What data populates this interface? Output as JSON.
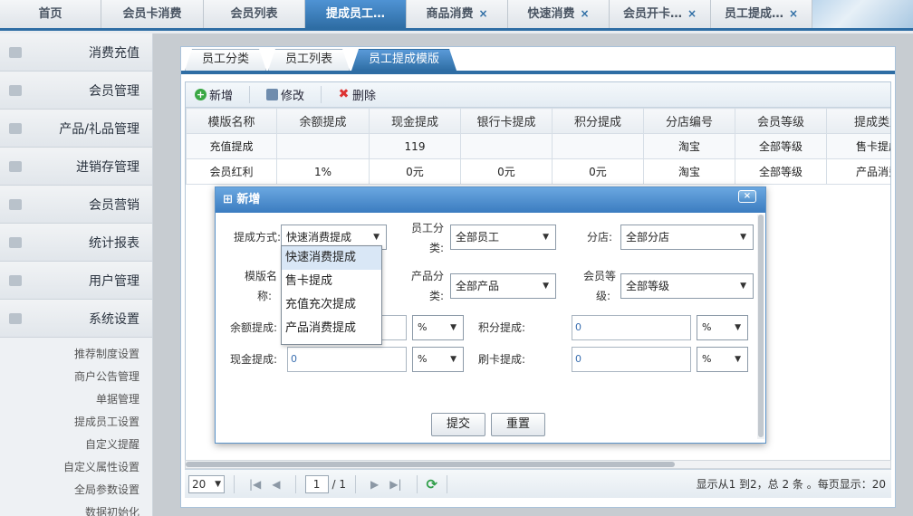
{
  "top_tabs": [
    {
      "label": "首页",
      "closable": false,
      "active": false
    },
    {
      "label": "会员卡消费",
      "closable": false,
      "active": false
    },
    {
      "label": "会员列表",
      "closable": false,
      "active": false
    },
    {
      "label": "提成员工…",
      "closable": false,
      "active": true
    },
    {
      "label": "商品消费",
      "closable": true,
      "active": false
    },
    {
      "label": "快速消费",
      "closable": true,
      "active": false
    },
    {
      "label": "会员开卡…",
      "closable": true,
      "active": false
    },
    {
      "label": "员工提成…",
      "closable": true,
      "active": false
    }
  ],
  "tab_close_glyph": "×",
  "sidebar": {
    "items": [
      {
        "label": "消费充值",
        "icon": "user-icon"
      },
      {
        "label": "会员管理",
        "icon": "card-icon"
      },
      {
        "label": "产品/礼品管理",
        "icon": "gift-icon"
      },
      {
        "label": "进销存管理",
        "icon": "gift-icon"
      },
      {
        "label": "会员营销",
        "icon": "mail-icon"
      },
      {
        "label": "统计报表",
        "icon": "monitor-icon"
      },
      {
        "label": "用户管理",
        "icon": "lock-icon"
      },
      {
        "label": "系统设置",
        "icon": "gear-icon"
      }
    ],
    "sub_items": [
      "推荐制度设置",
      "商户公告管理",
      "单据管理",
      "提成员工设置",
      "自定义提醒",
      "自定义属性设置",
      "全局参数设置",
      "数据初始化"
    ]
  },
  "sub_tabs": [
    {
      "label": "员工分类",
      "active": false
    },
    {
      "label": "员工列表",
      "active": false
    },
    {
      "label": "员工提成模版",
      "active": true
    }
  ],
  "toolbar": {
    "add_label": "新增",
    "edit_label": "修改",
    "delete_label": "删除"
  },
  "grid": {
    "columns": [
      "模版名称",
      "余额提成",
      "现金提成",
      "银行卡提成",
      "积分提成",
      "分店编号",
      "会员等级",
      "提成类型"
    ],
    "rows": [
      [
        "充值提成",
        "",
        "119",
        "",
        "",
        "淘宝",
        "全部等级",
        "售卡提成"
      ],
      [
        "会员红利",
        "1%",
        "0元",
        "0元",
        "0元",
        "淘宝",
        "全部等级",
        "产品消费"
      ]
    ]
  },
  "pager": {
    "page_size": "20",
    "page_current": "1",
    "page_total": "/ 1",
    "info": "显示从1 到2，总 2 条 。每页显示：20"
  },
  "dialog": {
    "title": "新增",
    "close_glyph": "×",
    "labels": {
      "method": "提成方式:",
      "employee_cat_1": "员工分",
      "employee_cat_2": "类:",
      "branch": "分店:",
      "template_name_1": "模版名",
      "template_name_2": "称:",
      "product_cat_1": "产品分",
      "product_cat_2": "类:",
      "member_level_1": "会员等",
      "member_level_2": "级:",
      "balance": "余额提成:",
      "points": "积分提成:",
      "cash": "现金提成:",
      "card": "刷卡提成:"
    },
    "values": {
      "method": "快速消费提成",
      "employee_cat": "全部员工",
      "branch": "全部分店",
      "product_cat": "全部产品",
      "member_level": "全部等级",
      "balance_unit": "%",
      "points": "0",
      "points_unit": "%",
      "cash": "0",
      "cash_unit": "%",
      "card": "0",
      "card_unit": "%"
    },
    "dropdown_options": [
      "快速消费提成",
      "售卡提成",
      "充值充次提成",
      "产品消费提成"
    ],
    "submit_label": "提交",
    "reset_label": "重置"
  },
  "colors": {
    "accent": "#2e6da4",
    "dialog_header": "#3b7cc0",
    "highlight": "#d9e7f6"
  }
}
